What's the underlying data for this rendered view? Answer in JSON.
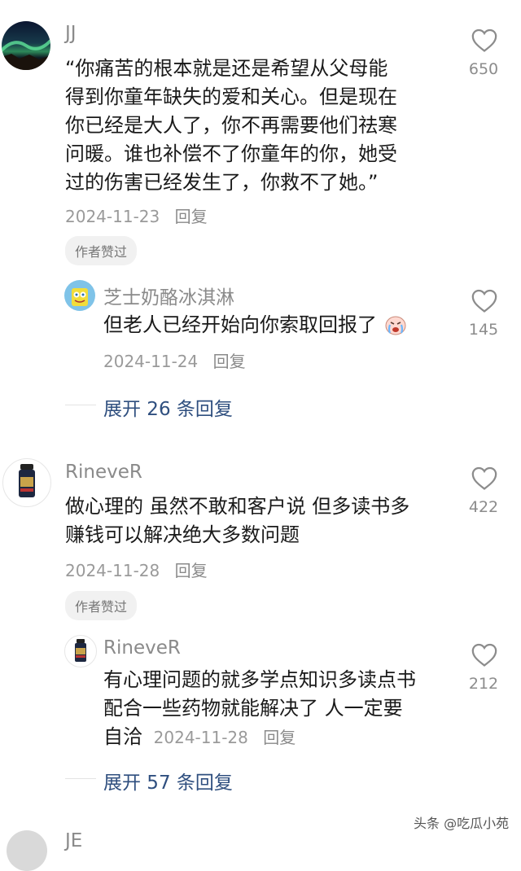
{
  "comments": [
    {
      "username": "JJ",
      "text": "“你痛苦的根本就是还是希望从父母能得到你童年缺失的爱和关心。但是现在你已经是大人了，你不再需要他们祛寒问暖。谁也补偿不了你童年的你，她受过的伤害已经发生了，你救不了她。”",
      "lines": [
        "“你痛苦的根本就是还是希望从父母能",
        "得到你童年缺失的爱和关心。但是现在",
        "你已经是大人了，你不再需要他们祛寒",
        "问暖。谁也补偿不了你童年的你，她受",
        "过的伤害已经发生了，你救不了她。”"
      ],
      "date": "2024-11-23",
      "reply_label": "回复",
      "author_liked": "作者赞过",
      "likes": "650",
      "reply": {
        "username": "芝士奶酪冰淇淋",
        "text": "但老人已经开始向你索取回报了",
        "date": "2024-11-24",
        "reply_label": "回复",
        "likes": "145"
      },
      "expand_label": "展开 26 条回复"
    },
    {
      "username": "RineveR",
      "lines": [
        "做心理的 虽然不敢和客户说 但多读书多",
        "赚钱可以解决绝大多数问题"
      ],
      "date": "2024-11-28",
      "reply_label": "回复",
      "author_liked": "作者赞过",
      "likes": "422",
      "reply": {
        "username": "RineveR",
        "lines": [
          "有心理问题的就多学点知识多读点书",
          "配合一些药物就能解决了 人一定要",
          "自洽"
        ],
        "date": "2024-11-28",
        "reply_label": "回复",
        "likes": "212"
      },
      "expand_label": "展开 57 条回复"
    }
  ],
  "partial_next_username": "JE",
  "watermark": "头条 @吃瓜小苑",
  "icons": {
    "like": "heart-outline-icon",
    "emoji": "crying-face-emoji-icon"
  },
  "colors": {
    "expand_link": "#2f4f7f",
    "meta": "#9a9a9a"
  }
}
